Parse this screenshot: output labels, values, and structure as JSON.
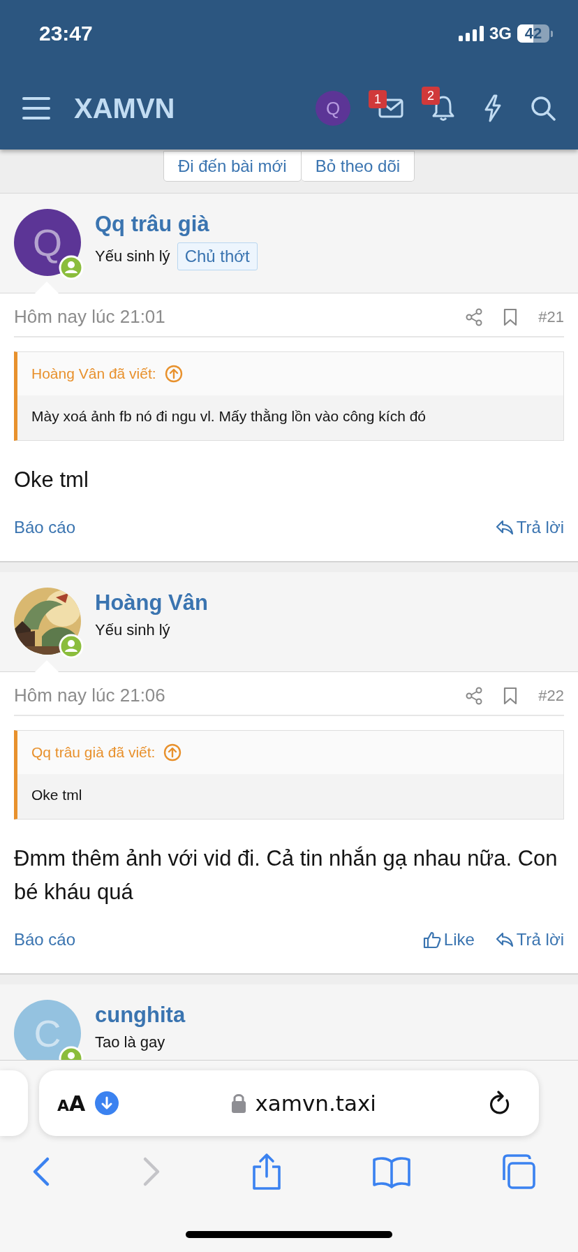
{
  "status_bar": {
    "time": "23:47",
    "network": "3G",
    "battery": "42"
  },
  "header": {
    "logo": "XAMVN",
    "account_letter": "Q",
    "message_count": "1",
    "alert_count": "2"
  },
  "thread_buttons": [
    "Đi đến bài mới",
    "Bỏ theo dõi"
  ],
  "posts": [
    {
      "author": "Qq trâu già",
      "avatar": {
        "kind": "letter",
        "letter": "Q",
        "color": "#5c3596"
      },
      "user_title": "Yếu sinh lý",
      "badge": "Chủ thớt",
      "date": "Hôm nay lúc 21:01",
      "number": "#21",
      "quote": {
        "attribution": "Hoàng Vân đã viết:",
        "text": "Mày xoá ảnh fb nó đi ngu vl. Mấy thằng lồn vào công kích đó"
      },
      "body": "Oke tml",
      "report": "Báo cáo",
      "reply": "Trả lời"
    },
    {
      "author": "Hoàng Vân",
      "user_title": "Yếu sinh lý",
      "date": "Hôm nay lúc 21:06",
      "number": "#22",
      "quote": {
        "attribution": "Qq trâu già đã viết:",
        "text": "Oke tml"
      },
      "body": "Đmm thêm ảnh với vid đi. Cả tin nhắn gạ nhau nữa. Con bé kháu quá",
      "report": "Báo cáo",
      "like": "Like",
      "reply": "Trả lời"
    },
    {
      "author": "cunghita",
      "avatar": {
        "kind": "letter",
        "letter": "C",
        "color": "#94c2e0"
      },
      "user_title": "Tao là gay"
    }
  ],
  "browser": {
    "text_size": "AA",
    "url": "xamvn.taxi"
  }
}
